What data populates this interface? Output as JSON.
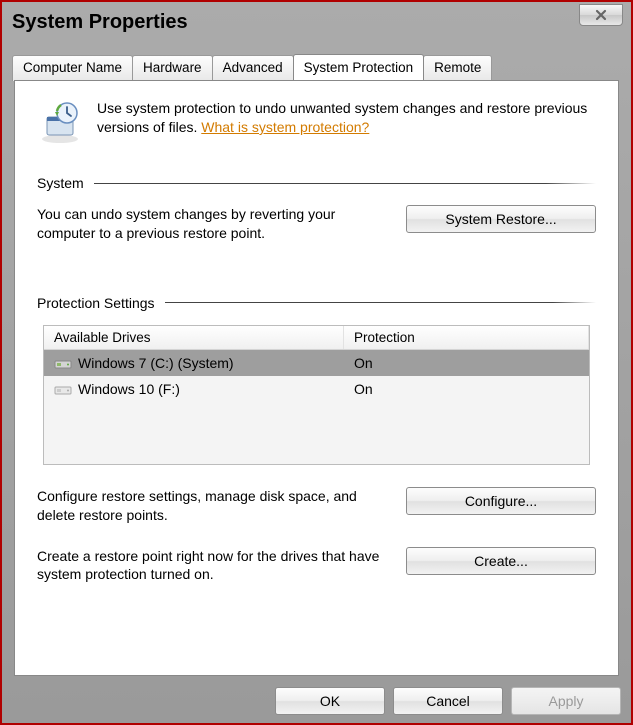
{
  "window": {
    "title": "System Properties"
  },
  "tabs": [
    {
      "label": "Computer Name"
    },
    {
      "label": "Hardware"
    },
    {
      "label": "Advanced"
    },
    {
      "label": "System Protection",
      "active": true
    },
    {
      "label": "Remote"
    }
  ],
  "intro": {
    "text": "Use system protection to undo unwanted system changes and restore previous versions of files. ",
    "link": "What is system protection?"
  },
  "section_system": {
    "heading": "System",
    "desc": "You can undo system changes by reverting your computer to a previous restore point.",
    "button": "System Restore..."
  },
  "section_protection": {
    "heading": "Protection Settings",
    "columns": {
      "c1": "Available Drives",
      "c2": "Protection"
    },
    "rows": [
      {
        "name": "Windows 7 (C:) (System)",
        "protection": "On",
        "selected": true,
        "icon": "drive-system"
      },
      {
        "name": "Windows 10 (F:)",
        "protection": "On",
        "selected": false,
        "icon": "drive"
      }
    ],
    "configure": {
      "desc": "Configure restore settings, manage disk space, and delete restore points.",
      "button": "Configure..."
    },
    "create": {
      "desc": "Create a restore point right now for the drives that have system protection turned on.",
      "button": "Create..."
    }
  },
  "footer": {
    "ok": "OK",
    "cancel": "Cancel",
    "apply": "Apply"
  }
}
